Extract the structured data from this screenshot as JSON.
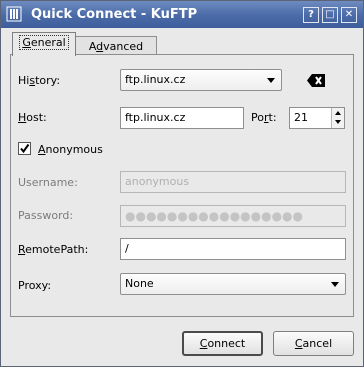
{
  "window": {
    "title": "Quick Connect - KuFTP",
    "buttons": {
      "help": "?",
      "maximize": "□",
      "close": "✕"
    }
  },
  "tabs": [
    {
      "label_underline": "G",
      "label_rest": "eneral",
      "active": true
    },
    {
      "label_before": "A",
      "label_underline": "d",
      "label_rest": "vanced",
      "active": false
    }
  ],
  "form": {
    "history": {
      "label_pre": "Hi",
      "label_u": "s",
      "label_post": "tory:",
      "value": "ftp.linux.cz"
    },
    "host": {
      "label_u": "H",
      "label_post": "ost:",
      "value": "ftp.linux.cz"
    },
    "port": {
      "label_pre": "Po",
      "label_u": "r",
      "label_post": "t:",
      "value": "21"
    },
    "anonymous": {
      "label_u": "A",
      "label_post": "nonymous",
      "checked": true
    },
    "username": {
      "label": "Username:",
      "value": "anonymous",
      "disabled": true
    },
    "password": {
      "label": "Password:",
      "value": "●●●●●●●●●●●●●●●●●",
      "disabled": true
    },
    "remote_path": {
      "label_u": "R",
      "label_post": "emotePath:",
      "value": "/"
    },
    "proxy": {
      "label": "Proxy:",
      "value": "None"
    }
  },
  "footer": {
    "connect": {
      "label_u": "C",
      "label_post": "onnect"
    },
    "cancel": {
      "label_u": "C",
      "label_post": "ancel"
    }
  },
  "colors": {
    "titlebar": "#4a6aa8",
    "window_bg": "#eae9ea"
  }
}
